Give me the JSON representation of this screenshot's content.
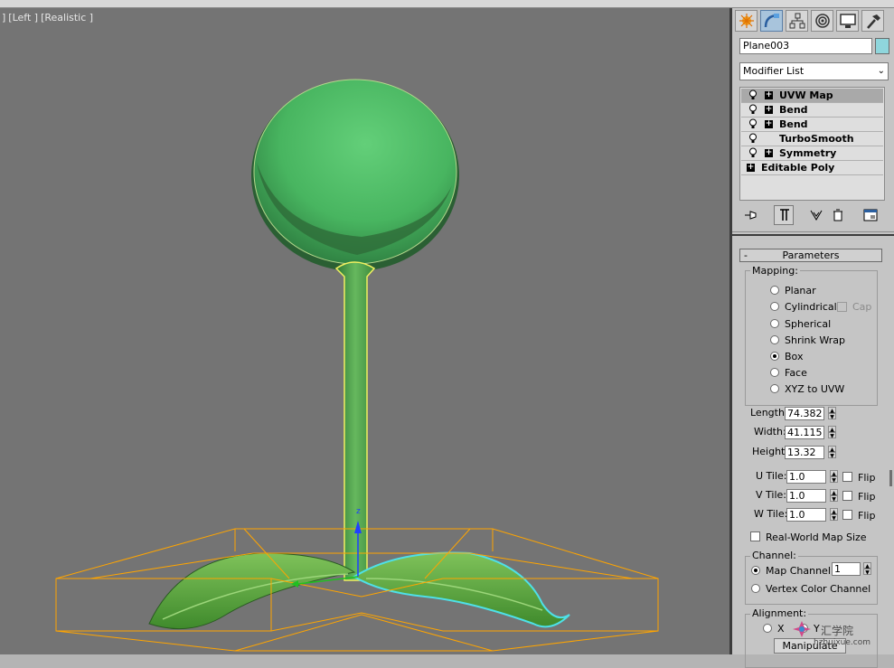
{
  "viewport": {
    "labels": [
      "]",
      "[Left ]",
      "[Realistic ]"
    ],
    "gizmo_axis": "z",
    "background": "#747474",
    "accent_selection": "#ffa500"
  },
  "command_panel": {
    "tabs": [
      {
        "icon": "create-icon"
      },
      {
        "icon": "modify-icon",
        "active": true
      },
      {
        "icon": "hierarchy-icon"
      },
      {
        "icon": "motion-icon"
      },
      {
        "icon": "display-icon"
      },
      {
        "icon": "utilities-icon"
      }
    ],
    "object_name": "Plane003",
    "object_color": "#8fd6dc",
    "modifier_list": "Modifier List",
    "stack": [
      {
        "label": "UVW Map",
        "expand": true,
        "bulb": true,
        "selected": true
      },
      {
        "label": "Bend",
        "expand": true,
        "bulb": true
      },
      {
        "label": "Bend",
        "expand": true,
        "bulb": true
      },
      {
        "label": "TurboSmooth",
        "expand": false,
        "bulb": true
      },
      {
        "label": "Symmetry",
        "expand": true,
        "bulb": true
      },
      {
        "label": "Editable Poly",
        "expand": true,
        "bulb": false
      }
    ],
    "stack_tools": [
      "pin-stack-icon",
      "show-end-result-icon",
      "make-unique-icon",
      "remove-modifier-icon",
      "configure-sets-icon"
    ]
  },
  "parameters": {
    "rollout_title": "Parameters",
    "rollout_toggle": "-",
    "mapping": {
      "title": "Mapping:",
      "options": [
        "Planar",
        "Cylindrical",
        "Spherical",
        "Shrink Wrap",
        "Box",
        "Face",
        "XYZ to UVW"
      ],
      "selected": "Box",
      "cap_label": "Cap"
    },
    "length_label": "Length:",
    "length": "74.382",
    "width_label": "Width:",
    "width": "41.115",
    "height_label": "Height:",
    "height": "13.32",
    "utile_label": "U Tile:",
    "utile": "1.0",
    "vtile_label": "V Tile:",
    "vtile": "1.0",
    "wtile_label": "W Tile:",
    "wtile": "1.0",
    "flip_label": "Flip",
    "real_world_label": "Real-World Map Size",
    "channel": {
      "title": "Channel:",
      "map_channel_label": "Map Channel:",
      "map_channel_value": "1",
      "vertex_color_label": "Vertex Color Channel"
    },
    "alignment": {
      "title": "Alignment:",
      "x_label": "X",
      "y_label": "Y",
      "manipulate_label": "Manipulate"
    }
  },
  "watermark": {
    "text": "汇学院",
    "url": "hzhuixue.com"
  }
}
